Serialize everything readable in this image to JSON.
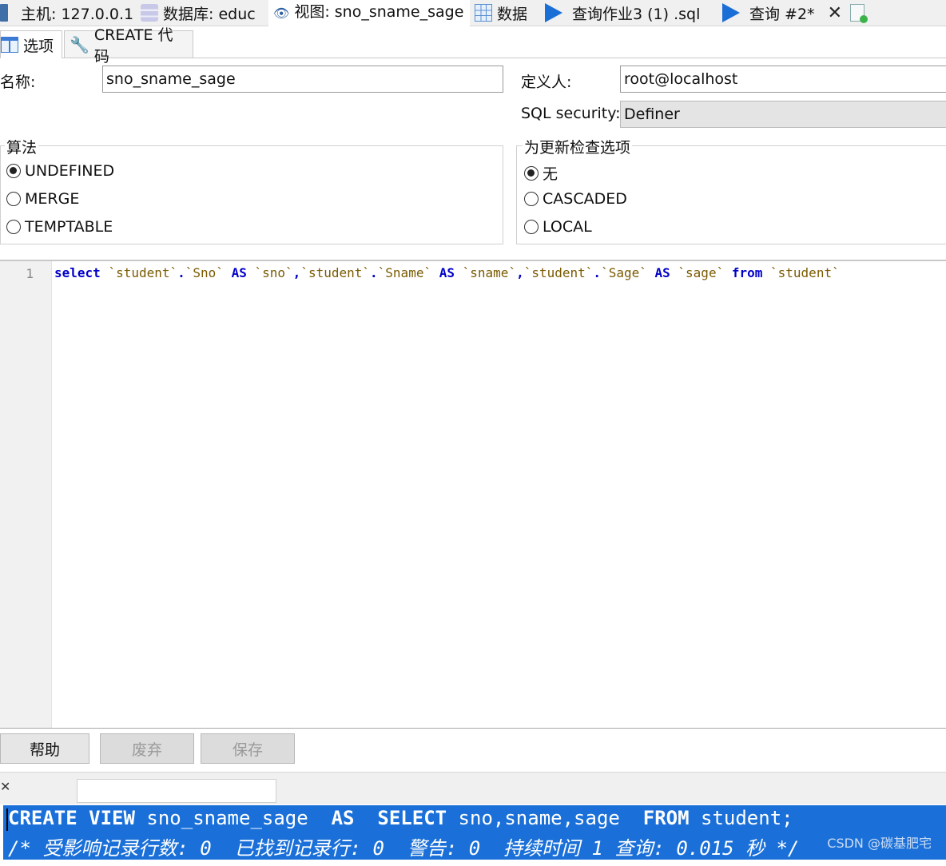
{
  "top_tabs": [
    {
      "label": "主机: 127.0.0.1",
      "icon": "host-icon"
    },
    {
      "label": "数据库: educ",
      "icon": "database-icon"
    },
    {
      "label": "视图: sno_sname_sage",
      "icon": "eye-icon"
    },
    {
      "label": "数据",
      "icon": "grid-icon"
    },
    {
      "label": "查询作业3 (1) .sql",
      "icon": "play-icon"
    },
    {
      "label": "查询 #2*",
      "icon": "play-icon"
    }
  ],
  "sub_tabs": [
    {
      "label": "选项",
      "icon": "table-icon"
    },
    {
      "label": "CREATE 代码",
      "icon": "wrench-icon"
    }
  ],
  "form": {
    "name_label": "名称:",
    "name_value": "sno_sname_sage",
    "definer_label": "定义人:",
    "definer_value": "root@localhost",
    "security_label": "SQL security:",
    "security_value": "Definer"
  },
  "algorithm": {
    "title": "算法",
    "options": [
      "UNDEFINED",
      "MERGE",
      "TEMPTABLE"
    ],
    "selected": "UNDEFINED"
  },
  "check_option": {
    "title": "为更新检查选项",
    "options": [
      "无",
      "CASCADED",
      "LOCAL"
    ],
    "selected": "无"
  },
  "editor": {
    "line_number": "1",
    "tokens": [
      {
        "t": "select",
        "c": "kw"
      },
      {
        "t": " ",
        "c": ""
      },
      {
        "t": "`student`",
        "c": "idf"
      },
      {
        "t": ".",
        "c": "pun"
      },
      {
        "t": "`Sno`",
        "c": "idf"
      },
      {
        "t": " ",
        "c": ""
      },
      {
        "t": "AS",
        "c": "kw"
      },
      {
        "t": " ",
        "c": ""
      },
      {
        "t": "`sno`",
        "c": "idf"
      },
      {
        "t": ",",
        "c": "pun"
      },
      {
        "t": "`student`",
        "c": "idf"
      },
      {
        "t": ".",
        "c": "pun"
      },
      {
        "t": "`Sname`",
        "c": "idf"
      },
      {
        "t": " ",
        "c": ""
      },
      {
        "t": "AS",
        "c": "kw"
      },
      {
        "t": " ",
        "c": ""
      },
      {
        "t": "`sname`",
        "c": "idf"
      },
      {
        "t": ",",
        "c": "pun"
      },
      {
        "t": "`student`",
        "c": "idf"
      },
      {
        "t": ".",
        "c": "pun"
      },
      {
        "t": "`Sage`",
        "c": "idf"
      },
      {
        "t": " ",
        "c": ""
      },
      {
        "t": "AS",
        "c": "kw"
      },
      {
        "t": " ",
        "c": ""
      },
      {
        "t": "`sage`",
        "c": "idf"
      },
      {
        "t": " ",
        "c": ""
      },
      {
        "t": "from",
        "c": "kw"
      },
      {
        "t": " ",
        "c": ""
      },
      {
        "t": "`student`",
        "c": "idf"
      }
    ]
  },
  "buttons": {
    "help": "帮助",
    "discard": "废弃",
    "save": "保存"
  },
  "output": {
    "line1_tokens": [
      {
        "t": "CREATE VIEW",
        "b": true
      },
      {
        "t": " sno_sname_sage  ",
        "b": false
      },
      {
        "t": "AS",
        "b": true
      },
      {
        "t": "  ",
        "b": false
      },
      {
        "t": "SELECT",
        "b": true
      },
      {
        "t": " sno,sname,sage  ",
        "b": false
      },
      {
        "t": "FROM",
        "b": true
      },
      {
        "t": " student;",
        "b": false
      }
    ],
    "line2": "/* 受影响记录行数: 0  已找到记录行: 0  警告: 0  持续时间 1 查询: 0.015 秒 */"
  },
  "watermark": "CSDN @碳基肥宅",
  "colors": {
    "keyword": "#0000c8",
    "identifier": "#7a5a00",
    "output_bg": "#1a70d8"
  }
}
